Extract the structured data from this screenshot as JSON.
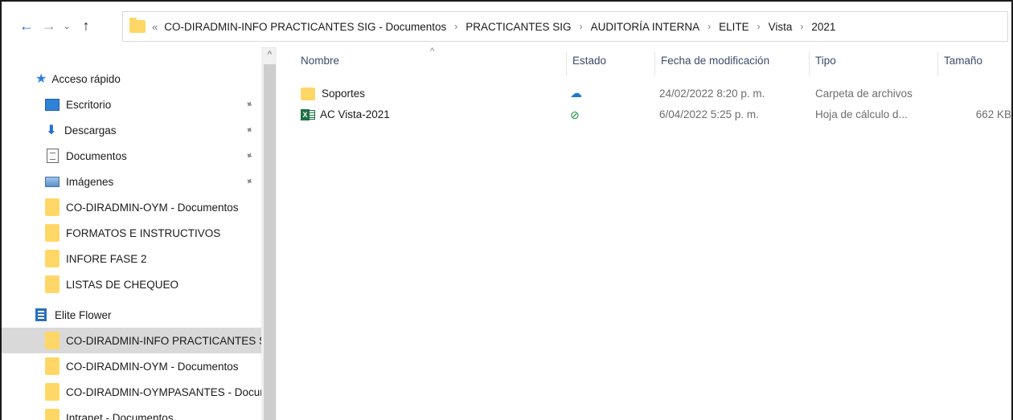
{
  "navigation": {
    "back_glyph": "←",
    "forward_glyph": "→",
    "recent_glyph": "⌄",
    "up_glyph": "↑"
  },
  "address_bar": {
    "overflow_glyph": "«",
    "separator": "›",
    "path": [
      "CO-DIRADMIN-INFO PRACTICANTES SIG - Documentos",
      "PRACTICANTES SIG",
      "AUDITORÍA INTERNA",
      "ELITE",
      "Vista",
      "2021"
    ]
  },
  "sidebar": {
    "scroll_up_glyph": "^",
    "pin_glyph": "✦",
    "quick_access": {
      "label": "Acceso rápido",
      "items": [
        {
          "label": "Escritorio",
          "icon": "desktop-icon",
          "pinned": true
        },
        {
          "label": "Descargas",
          "icon": "download-icon",
          "pinned": true
        },
        {
          "label": "Documentos",
          "icon": "documents-icon",
          "pinned": true
        },
        {
          "label": "Imágenes",
          "icon": "images-icon",
          "pinned": true
        },
        {
          "label": "CO-DIRADMIN-OYM - Documentos",
          "icon": "folder-icon",
          "pinned": false
        },
        {
          "label": "FORMATOS E INSTRUCTIVOS",
          "icon": "folder-icon",
          "pinned": false
        },
        {
          "label": "INFORE FASE 2",
          "icon": "folder-icon",
          "pinned": false
        },
        {
          "label": "LISTAS DE CHEQUEO",
          "icon": "folder-icon",
          "pinned": false
        }
      ]
    },
    "org": {
      "label": "Elite Flower",
      "items": [
        {
          "label": "CO-DIRADMIN-INFO PRACTICANTES SIG",
          "selected": true
        },
        {
          "label": "CO-DIRADMIN-OYM - Documentos",
          "selected": false
        },
        {
          "label": "CO-DIRADMIN-OYMPASANTES - Documentos",
          "selected": false
        },
        {
          "label": "Intranet - Documentos",
          "selected": false
        }
      ]
    }
  },
  "file_list": {
    "sort_glyph": "^",
    "columns": {
      "name": "Nombre",
      "status": "Estado",
      "modified": "Fecha de modificación",
      "type": "Tipo",
      "size": "Tamaño"
    },
    "rows": [
      {
        "name": "Soportes",
        "icon": "folder-icon",
        "status_icon": "cloud-icon",
        "status_glyph": "☁",
        "modified": "24/02/2022 8:20 p. m.",
        "type": "Carpeta de archivos",
        "size": ""
      },
      {
        "name": "AC Vista-2021",
        "icon": "excel-icon",
        "status_icon": "check-circle-icon",
        "status_glyph": "⊘",
        "modified": "6/04/2022 5:25 p. m.",
        "type": "Hoja de cálculo d...",
        "size": "662 KB"
      }
    ]
  },
  "colors": {
    "accent_blue": "#1f6fd0",
    "folder_yellow": "#ffd766",
    "selection_gray": "#d9d9d9",
    "excel_green": "#1e7145"
  }
}
